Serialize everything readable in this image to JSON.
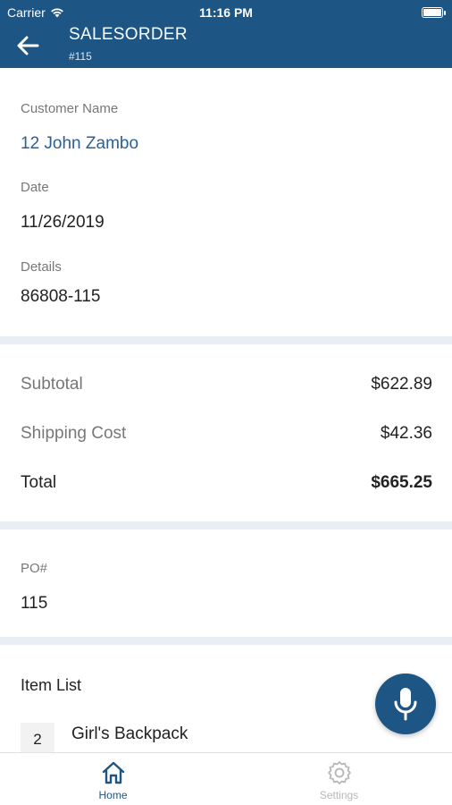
{
  "status_bar": {
    "carrier": "Carrier",
    "time": "11:16 PM"
  },
  "header": {
    "title": "SALESORDER",
    "subtitle": "#115"
  },
  "customer": {
    "name_label": "Customer Name",
    "name_value": "12 John Zambo",
    "date_label": "Date",
    "date_value": "11/26/2019",
    "details_label": "Details",
    "details_value": "86808-115"
  },
  "totals": {
    "subtotal_label": "Subtotal",
    "subtotal_value": "$622.89",
    "shipping_label": "Shipping Cost",
    "shipping_value": "$42.36",
    "total_label": "Total",
    "total_value": "$665.25"
  },
  "po": {
    "label": "PO#",
    "value": "115"
  },
  "items": {
    "title": "Item List",
    "list": [
      {
        "qty": "2",
        "name": "Girl's Backpack"
      }
    ]
  },
  "tabbar": {
    "tabs": [
      {
        "label": "Home",
        "icon": "home-icon",
        "active": true
      },
      {
        "label": "Settings",
        "icon": "gear-icon",
        "active": false
      }
    ]
  },
  "colors": {
    "primary": "#1d5584",
    "link": "#2c5f93",
    "divider": "#e9eef4"
  }
}
